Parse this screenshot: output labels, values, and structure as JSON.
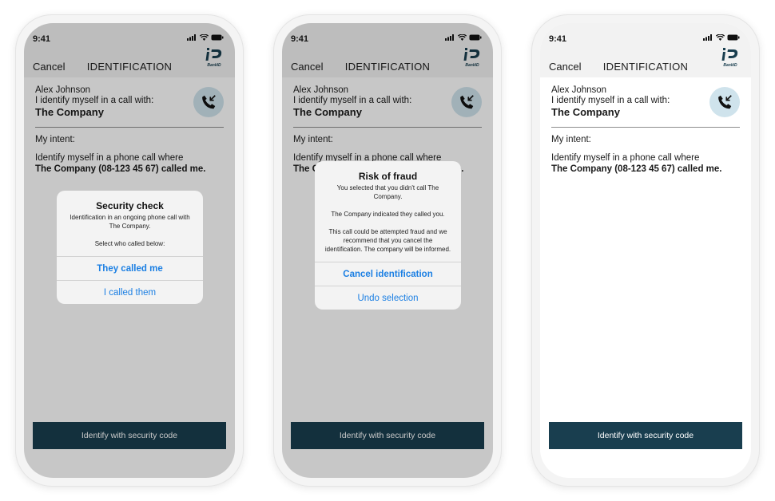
{
  "status": {
    "time": "9:41"
  },
  "nav": {
    "cancel": "Cancel",
    "title": "IDENTIFICATION",
    "logo_text": "BankID"
  },
  "identity": {
    "name": "Alex Johnson",
    "call_with": "I identify myself in a call with:",
    "company": "The Company"
  },
  "intent": {
    "label": "My intent:",
    "line1": "Identify myself in a phone call where",
    "line2": "The Company (08-123 45 67) called me."
  },
  "identify_button": "Identify with security code",
  "security_dialog": {
    "title": "Security check",
    "body1": "Identification in an ongoing phone call with The Company.",
    "body2": "Select who called below:",
    "primary": "They called me",
    "secondary": "I called them"
  },
  "fraud_dialog": {
    "title": "Risk of fraud",
    "body1": "You selected that you didn't call The Company.",
    "body2": "The Company indicated they called you.",
    "body3": "This call could be attempted fraud and we recommend that you cancel the identification. The company will be informed.",
    "primary": "Cancel identification",
    "secondary": "Undo selection"
  },
  "colors": {
    "accent": "#1b7fe3",
    "button_bg": "#193e4f",
    "call_circle": "#cfe3ec"
  },
  "icons": [
    "signal-icon",
    "wifi-icon",
    "battery-icon",
    "bankid-logo",
    "incoming-call-icon"
  ]
}
